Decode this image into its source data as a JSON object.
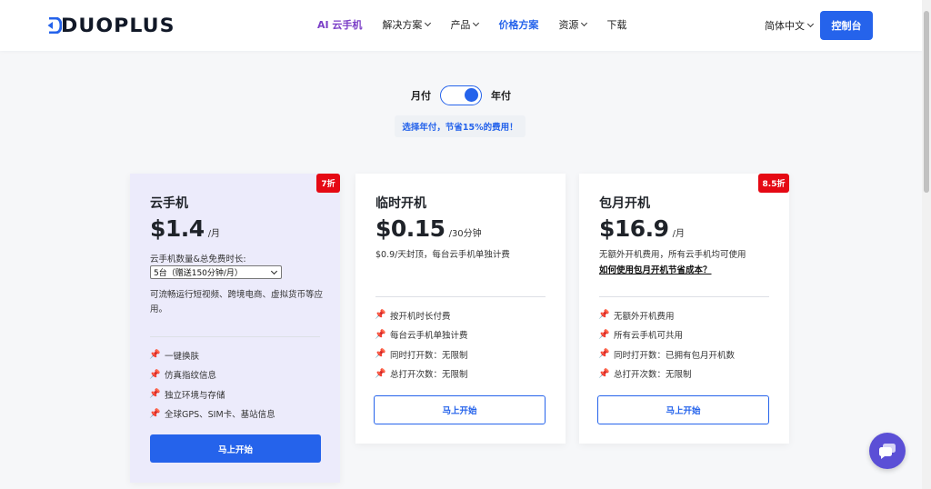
{
  "header": {
    "logo_text": "DUOPLUS",
    "nav": [
      {
        "label": "AI 云手机",
        "dropdown": false
      },
      {
        "label": "解决方案",
        "dropdown": true
      },
      {
        "label": "产品",
        "dropdown": true
      },
      {
        "label": "价格方案",
        "dropdown": false
      },
      {
        "label": "资源",
        "dropdown": true
      },
      {
        "label": "下载",
        "dropdown": false
      }
    ],
    "language": "简体中文",
    "console_button": "控制台"
  },
  "billing": {
    "monthly_label": "月付",
    "yearly_label": "年付",
    "selected": "yearly",
    "save_hint": "选择年付，节省15%的费用！"
  },
  "plans": [
    {
      "badge": "7折",
      "title": "云手机",
      "price": "$1.4",
      "unit": "/月",
      "count_label": "云手机数量&总免费时长:",
      "select_value": "5台（赠送150分钟/月）",
      "description": "可流畅运行短视频、跨境电商、虚拟货币等应用。",
      "features": [
        "一键换肤",
        "仿真指纹信息",
        "独立环境与存储",
        "全球GPS、SIM卡、基站信息"
      ],
      "button": "马上开始"
    },
    {
      "title": "临时开机",
      "price": "$0.15",
      "unit": "/30分钟",
      "description": "$0.9/天封顶，每台云手机单独计费",
      "features": [
        "按开机时长付费",
        "每台云手机单独计费",
        "同时打开数：无限制",
        "总打开次数：无限制"
      ],
      "button": "马上开始"
    },
    {
      "badge": "8.5折",
      "title": "包月开机",
      "price": "$16.9",
      "unit": "/月",
      "description": "无额外开机费用，所有云手机均可使用",
      "link": "如何使用包月开机节省成本？",
      "features": [
        "无额外开机费用",
        "所有云手机可共用",
        "同时打开数：已拥有包月开机数",
        "总打开次数：无限制"
      ],
      "button": "马上开始"
    }
  ],
  "colors": {
    "accent": "#2563eb",
    "ai": "#7b3fc7",
    "badge": "#e50914",
    "featured_card": "#ecebfb"
  }
}
